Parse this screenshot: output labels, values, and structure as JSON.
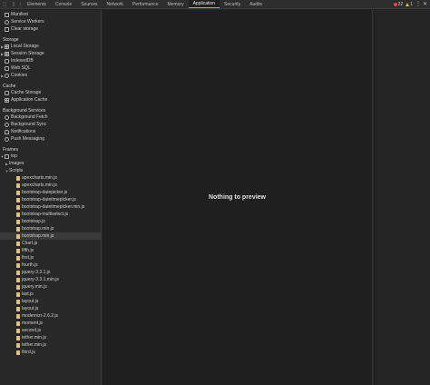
{
  "toolbar": {
    "tabs": [
      {
        "label": "Elements",
        "active": false
      },
      {
        "label": "Console",
        "active": false
      },
      {
        "label": "Sources",
        "active": false
      },
      {
        "label": "Network",
        "active": false
      },
      {
        "label": "Performance",
        "active": false
      },
      {
        "label": "Memory",
        "active": false
      },
      {
        "label": "Application",
        "active": true
      },
      {
        "label": "Security",
        "active": false
      },
      {
        "label": "Audits",
        "active": false
      }
    ],
    "error_count": "22",
    "warning_count": "1"
  },
  "sidebar": {
    "application": [
      {
        "label": "Manifest",
        "icon": "doc-icon"
      },
      {
        "label": "Service Workers",
        "icon": "gear-icon"
      },
      {
        "label": "Clear storage",
        "icon": "trash-icon"
      }
    ],
    "storage_title": "Storage",
    "storage": [
      {
        "label": "Local Storage",
        "icon": "grid-icon",
        "expandable": true
      },
      {
        "label": "Session Storage",
        "icon": "grid-icon",
        "expandable": true
      },
      {
        "label": "IndexedDB",
        "icon": "db-icon",
        "expandable": false
      },
      {
        "label": "Web SQL",
        "icon": "db-icon",
        "expandable": false
      },
      {
        "label": "Cookies",
        "icon": "cookie-icon",
        "expandable": true
      }
    ],
    "cache_title": "Cache",
    "cache": [
      {
        "label": "Cache Storage",
        "icon": "db-icon"
      },
      {
        "label": "Application Cache",
        "icon": "grid-icon"
      }
    ],
    "bg_title": "Background Services",
    "bg": [
      {
        "label": "Background Fetch",
        "icon": "sync-icon"
      },
      {
        "label": "Background Sync",
        "icon": "sync-icon"
      },
      {
        "label": "Notifications",
        "icon": "bell-icon"
      },
      {
        "label": "Push Messaging",
        "icon": "cloud-icon"
      }
    ],
    "frames_title": "Frames",
    "frames": {
      "top": "top",
      "images": "Images",
      "scripts": "Scripts",
      "files": [
        "apexcharts.min.js",
        "apexcharts.min.js",
        "bootstrap-datepicker.js",
        "bootstrap-datetimepicker.js",
        "bootstrap-datetimepicker.min.js",
        "bootstrap-multiselect.js",
        "bootstrap.js",
        "bootstrap.min.js",
        "bootstrap.min.js",
        "Chart.js",
        "fifth.js",
        "first.js",
        "fourth.js",
        "jquery-3.3.1.js",
        "jquery-3.3.1.min.js",
        "jquery.min.js",
        "last.js",
        "layout.js",
        "layout.js",
        "modernizr-2.6.2.js",
        "moment.js",
        "second.js",
        "tether.min.js",
        "tether.min.js",
        "third.js"
      ],
      "selected_index": 8
    }
  },
  "main": {
    "placeholder": "Nothing to preview"
  }
}
